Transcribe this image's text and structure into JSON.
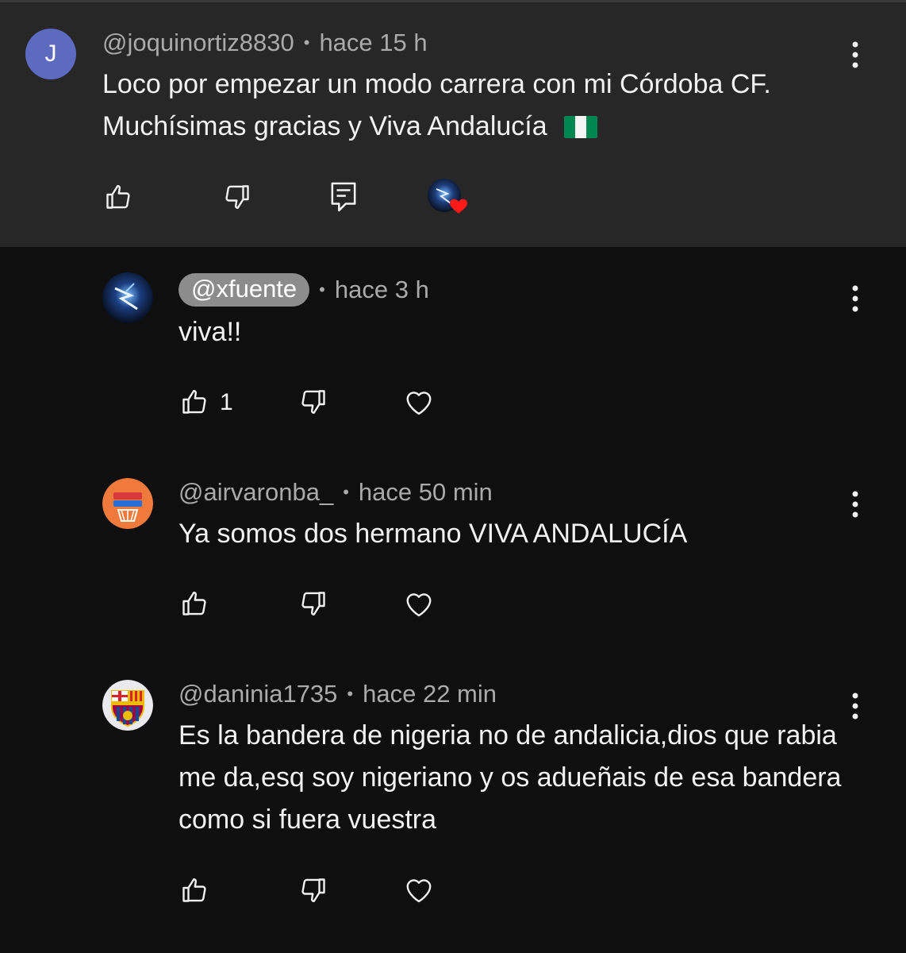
{
  "comments": [
    {
      "avatar_letter": "J",
      "handle": "@joquinortiz8830",
      "separator": "•",
      "time": "hace 15 h",
      "text": "Loco por empezar un modo carrera con mi Córdoba CF. Muchísimas gracias y Viva Andalucía",
      "flag_icon": "nigeria-flag-icon",
      "actions": [
        "like-icon",
        "dislike-icon",
        "reply-icon",
        "creator-heart-icon"
      ]
    }
  ],
  "replies": [
    {
      "handle": "@xfuente",
      "separator": "•",
      "time": "hace 3 h",
      "text": "viva!!",
      "like_count": "1"
    },
    {
      "handle": "@airvaronba_",
      "separator": "•",
      "time": "hace 50 min",
      "text": "Ya somos dos hermano VIVA ANDALUCÍA",
      "like_count": ""
    },
    {
      "handle": "@daninia1735",
      "separator": "•",
      "time": "hace 22 min",
      "text": "Es la bandera de nigeria no de andalicia,dios que rabia me da,esq soy nigeriano y os adueñais de esa bandera como si fuera vuestra",
      "like_count": ""
    }
  ],
  "colors": {
    "background": "#0f0f0f",
    "highlight_background": "#272727",
    "primary_text": "#f1f1f1",
    "secondary_text": "#aaaaaa",
    "creator_chip": "#8c8c8c",
    "heart": "#ff0000",
    "flag_green": "#008751"
  }
}
